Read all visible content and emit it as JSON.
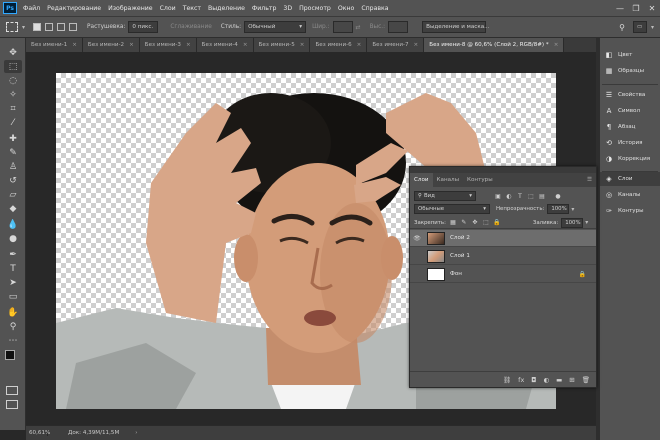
{
  "app": {
    "logo": "Ps"
  },
  "menu": [
    "Файл",
    "Редактирование",
    "Изображение",
    "Слои",
    "Текст",
    "Выделение",
    "Фильтр",
    "3D",
    "Просмотр",
    "Окно",
    "Справка"
  ],
  "window_controls": {
    "minimize": "—",
    "maximize": "❐",
    "close": "✕"
  },
  "options_bar": {
    "feather_label": "Растушевка:",
    "feather_value": "0 пикс.",
    "antialias_label": "Сглаживание",
    "style_label": "Стиль:",
    "style_value": "Обычный",
    "width_label": "Шир.:",
    "height_label": "Выс.:",
    "select_mask_button": "Выделение и маска..."
  },
  "tabs": [
    {
      "label": "Без имени-1"
    },
    {
      "label": "Без имени-2"
    },
    {
      "label": "Без имени-3"
    },
    {
      "label": "Без имени-4"
    },
    {
      "label": "Без имени-5"
    },
    {
      "label": "Без имени-6"
    },
    {
      "label": "Без имени-7"
    },
    {
      "label": "Без имени-8 @ 60,6% (Слой 2, RGB/8#) *",
      "active": true
    }
  ],
  "tab_close_glyph": "×",
  "tools": [
    {
      "name": "move-tool",
      "glyph": "✥"
    },
    {
      "name": "marquee-tool",
      "glyph": "⬚"
    },
    {
      "name": "lasso-tool",
      "glyph": "◌"
    },
    {
      "name": "magic-wand-tool",
      "glyph": "✧"
    },
    {
      "name": "crop-tool",
      "glyph": "⌗"
    },
    {
      "name": "eyedropper-tool",
      "glyph": "⁄"
    },
    {
      "name": "healing-brush-tool",
      "glyph": "✚"
    },
    {
      "name": "brush-tool",
      "glyph": "✎"
    },
    {
      "name": "clone-stamp-tool",
      "glyph": "♙"
    },
    {
      "name": "history-brush-tool",
      "glyph": "↺"
    },
    {
      "name": "eraser-tool",
      "glyph": "▱"
    },
    {
      "name": "paint-bucket-tool",
      "glyph": "◆"
    },
    {
      "name": "blur-tool",
      "glyph": "💧"
    },
    {
      "name": "dodge-tool",
      "glyph": "●"
    },
    {
      "name": "pen-tool",
      "glyph": "✒"
    },
    {
      "name": "type-tool",
      "glyph": "T"
    },
    {
      "name": "path-selection-tool",
      "glyph": "➤"
    },
    {
      "name": "rectangle-tool",
      "glyph": "▭"
    },
    {
      "name": "hand-tool",
      "glyph": "✋"
    },
    {
      "name": "zoom-tool",
      "glyph": "⚲"
    },
    {
      "name": "more-tools",
      "glyph": "⋯"
    }
  ],
  "dock": {
    "top_items": [
      {
        "label": "Цвет",
        "icon": "color-icon"
      },
      {
        "label": "Образцы",
        "icon": "swatches-icon"
      }
    ],
    "mid_items": [
      {
        "label": "Свойства",
        "icon": "properties-icon"
      },
      {
        "label": "Символ",
        "icon": "character-icon"
      },
      {
        "label": "Абзац",
        "icon": "paragraph-icon"
      },
      {
        "label": "История",
        "icon": "history-icon"
      },
      {
        "label": "Коррекция",
        "icon": "adjustments-icon"
      }
    ],
    "bottom_items": [
      {
        "label": "Слои",
        "icon": "layers-icon",
        "active": true
      },
      {
        "label": "Каналы",
        "icon": "channels-icon"
      },
      {
        "label": "Контуры",
        "icon": "paths-icon"
      }
    ]
  },
  "layers_panel": {
    "tabs": [
      "Слои",
      "Каналы",
      "Контуры"
    ],
    "filter_value": "Вид",
    "blend_mode": "Обычные",
    "opacity_label": "Непрозрачность:",
    "opacity_value": "100%",
    "lock_label": "Закрепить:",
    "fill_label": "Заливка:",
    "fill_value": "100%",
    "layers": [
      {
        "name": "Слой 2",
        "visible": true,
        "selected": true
      },
      {
        "name": "Слой 1",
        "visible": false,
        "selected": false
      },
      {
        "name": "Фон",
        "visible": false,
        "selected": false,
        "locked": true
      }
    ],
    "bottom_icons": [
      "link-icon",
      "fx-icon",
      "mask-icon",
      "adjustment-icon",
      "folder-icon",
      "new-layer-icon",
      "trash-icon"
    ]
  },
  "status": {
    "zoom": "60,61%",
    "doc_info": "Док: 4,39M/11,5M"
  }
}
